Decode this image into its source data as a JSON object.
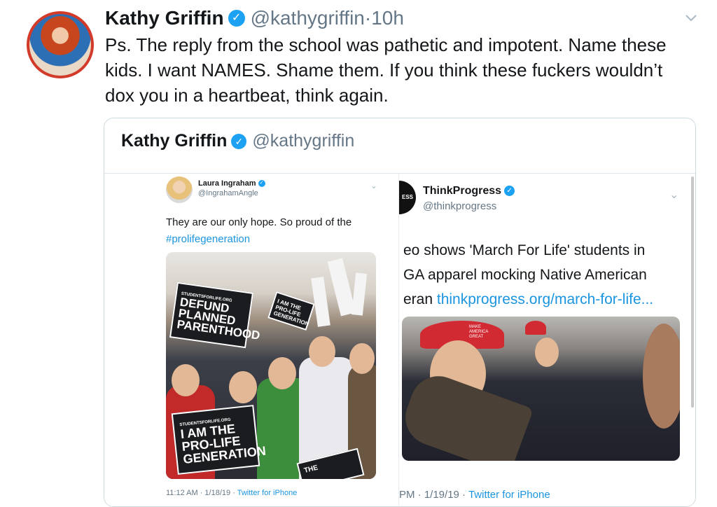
{
  "tweet": {
    "author_name": "Kathy Griffin",
    "handle": "@kathygriffin",
    "separator": "·",
    "time": "10h",
    "text": "Ps. The reply from the school was pathetic and impotent. Name these\nkids. I want NAMES. Shame them. If you think these fuckers wouldn’t\ndox you in a heartbeat, think again."
  },
  "quoted": {
    "author_name": "Kathy Griffin",
    "handle": "@kathygriffin",
    "left": {
      "author_name": "Laura Ingraham",
      "handle": "@IngrahamAngle",
      "text": "They are our only hope.  So proud of the",
      "hashtag": "#prolifegeneration",
      "sign1": "DEFUND PLANNED PARENTHOOD",
      "sign1_small": "STUDENTSFORLIFE.ORG",
      "sign2": "I AM THE PRO-LIFE GENERATION",
      "sign2_small": "STUDENTSFORLIFE.ORG",
      "sign3": "I AM THE PRO-LIFE GENERATION",
      "sign4": "THE",
      "timestamp": "11:12 AM · 1/18/19 · ",
      "source": "Twitter for iPhone"
    },
    "right": {
      "avatar_text": "ESS",
      "author_name": "ThinkProgress",
      "handle": "@thinkprogress",
      "text": "eo shows 'March For Life' students in\nGA apparel mocking Native American\neran ",
      "link": "thinkprogress.org/march-for-life...",
      "cap_text": "MAKE AMERICA GREAT",
      "timestamp": " PM · 1/19/19 · ",
      "source": "Twitter for iPhone"
    }
  },
  "colors": {
    "link": "#1b95e0",
    "verified": "#1da1f2",
    "muted": "#657786"
  }
}
